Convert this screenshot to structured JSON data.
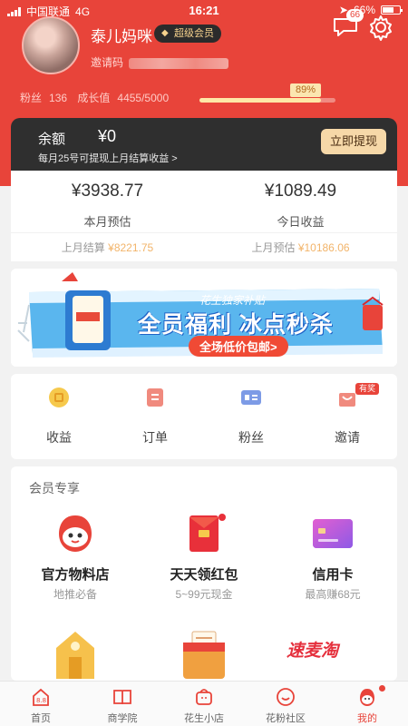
{
  "status_bar": {
    "carrier": "中国联通",
    "network": "4G",
    "time": "16:21",
    "battery": "66%"
  },
  "profile": {
    "name": "泰儿妈咪",
    "vip_label": "超级会员",
    "invite_prefix": "邀请码",
    "message_count": "66",
    "fans_label": "粉丝",
    "fans_value": "136",
    "growth_label": "成长值",
    "growth_value": "4455/5000",
    "growth_percent_label": "89%",
    "growth_progress": 0.89
  },
  "balance": {
    "label": "余额",
    "value": "¥0",
    "note": "每月25号可提现上月结算收益 >",
    "withdraw_label": "立即提现"
  },
  "earnings": [
    {
      "amount": "¥3938.77",
      "label": "本月预估",
      "sub_label": "上月结算",
      "sub_value": "¥8221.75"
    },
    {
      "amount": "¥1089.49",
      "label": "今日收益",
      "sub_label": "上月预估",
      "sub_value": "¥10186.06"
    }
  ],
  "banner": {
    "subtitle": "花生独家补贴",
    "title": "全员福利 冰点秒杀",
    "tag": "全场低价包邮>"
  },
  "quick_actions": [
    {
      "label": "收益",
      "icon": "coin-icon"
    },
    {
      "label": "订单",
      "icon": "order-icon"
    },
    {
      "label": "粉丝",
      "icon": "fans-card-icon"
    },
    {
      "label": "邀请",
      "icon": "gift-icon",
      "badge": "有奖"
    }
  ],
  "member": {
    "title": "会员专享",
    "items": [
      {
        "name": "官方物料店",
        "desc": "地推必备",
        "icon": "mascot-icon"
      },
      {
        "name": "天天领红包",
        "desc": "5~99元现金",
        "icon": "red-envelope-icon"
      },
      {
        "name": "信用卡",
        "desc": "最高赚68元",
        "icon": "credit-card-icon"
      }
    ],
    "row2": [
      {
        "icon": "building-icon"
      },
      {
        "icon": "wallet-icon"
      },
      {
        "text": "速麦淘",
        "icon": "sumaitao-logo"
      }
    ]
  },
  "tabs": [
    {
      "label": "首页",
      "icon": "home-icon"
    },
    {
      "label": "商学院",
      "icon": "book-icon"
    },
    {
      "label": "花生小店",
      "icon": "shop-icon"
    },
    {
      "label": "花粉社区",
      "icon": "community-icon"
    },
    {
      "label": "我的",
      "icon": "profile-icon",
      "active": true
    }
  ],
  "colors": {
    "primary_red": "#e8443a",
    "dark_card": "#2f2f2f",
    "gold": "#f6d8a8"
  }
}
